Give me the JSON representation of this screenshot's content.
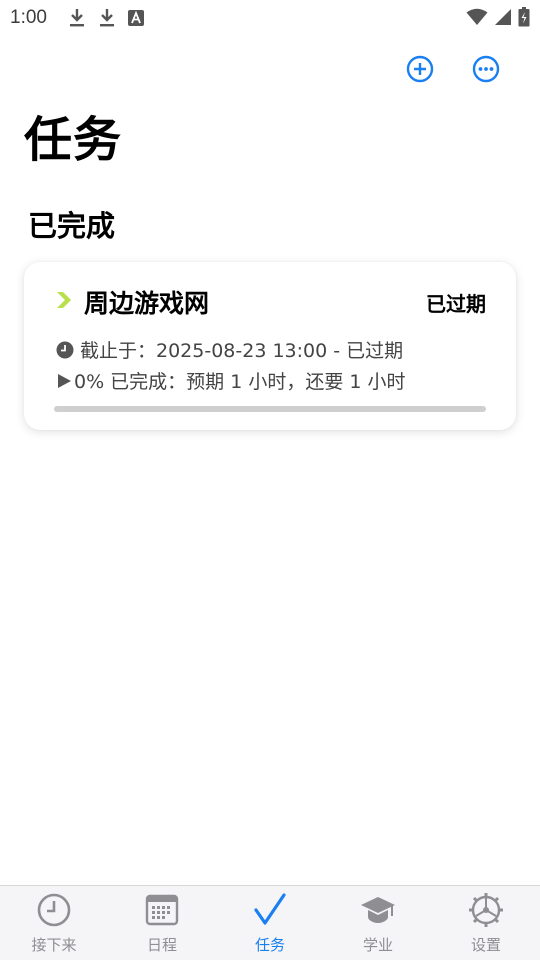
{
  "status_bar": {
    "time": "1:00"
  },
  "header": {
    "title": "任务",
    "actions": [
      "add-icon",
      "more-icon"
    ]
  },
  "section": {
    "title": "已完成"
  },
  "task": {
    "title": "周边游戏网",
    "status": "已过期",
    "due": "截止于：2025-08-23 13:00 - 已过期",
    "progress_text": "0% 已完成：预期 1 小时，还要 1 小时",
    "progress": 0,
    "accent_color": "#b8e04a"
  },
  "tabs": [
    {
      "label": "接下来",
      "icon": "clock-icon",
      "active": false
    },
    {
      "label": "日程",
      "icon": "calendar-icon",
      "active": false
    },
    {
      "label": "任务",
      "icon": "checkmark-icon",
      "active": true
    },
    {
      "label": "学业",
      "icon": "graduation-cap-icon",
      "active": false
    },
    {
      "label": "设置",
      "icon": "gear-icon",
      "active": false
    }
  ],
  "colors": {
    "accent": "#1a7ff0",
    "inactive": "#8e8e93"
  }
}
